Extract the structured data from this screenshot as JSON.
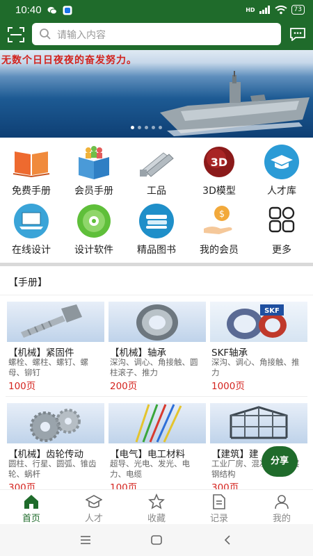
{
  "status": {
    "time": "10:40",
    "network": "HD",
    "battery": "73"
  },
  "search": {
    "placeholder": "请输入内容"
  },
  "banner": {
    "slogan": "无数个日日夜夜的奋发努力。",
    "slides": 5,
    "current": 1
  },
  "menu": [
    {
      "label": "免费手册",
      "icon": "open-book-icon"
    },
    {
      "label": "会员手册",
      "icon": "member-book-icon"
    },
    {
      "label": "工品",
      "icon": "aluminum-profile-icon"
    },
    {
      "label": "3D模型",
      "icon": "3d-model-icon"
    },
    {
      "label": "人才库",
      "icon": "graduation-cap-icon"
    },
    {
      "label": "在线设计",
      "icon": "laptop-icon"
    },
    {
      "label": "设计软件",
      "icon": "disc-icon"
    },
    {
      "label": "精品图书",
      "icon": "books-icon"
    },
    {
      "label": "我的会员",
      "icon": "money-hand-icon"
    },
    {
      "label": "更多",
      "icon": "more-grid-icon"
    }
  ],
  "section": {
    "title": "【手册】"
  },
  "cards": [
    {
      "title": "【机械】紧固件",
      "desc": "螺栓、螺柱、螺钉、螺母、铆钉",
      "pages": "100页",
      "icon": "bolt-icon"
    },
    {
      "title": "【机械】轴承",
      "desc": "深沟、调心、角接触、圆柱滚子、推力",
      "pages": "200页",
      "icon": "bearing-icon"
    },
    {
      "title": "SKF轴承",
      "desc": "深沟、调心、角接触、推力",
      "pages": "1000页",
      "icon": "skf-bearing-icon"
    },
    {
      "title": "【机械】齿轮传动",
      "desc": "圆柱、行星、圆弧、锥齿轮、蜗杆",
      "pages": "300页",
      "icon": "gears-icon"
    },
    {
      "title": "【电气】电工材料",
      "desc": "超导、光电、发光、电力、电缆",
      "pages": "100页",
      "icon": "wires-icon"
    },
    {
      "title": "【建筑】建",
      "desc": "工业厂房、混凝土、高层钢结构",
      "pages": "300页",
      "icon": "steel-frame-icon"
    }
  ],
  "share": {
    "label": "分享"
  },
  "tabs": [
    {
      "label": "首页",
      "icon": "home-icon",
      "active": true
    },
    {
      "label": "人才",
      "icon": "cap-icon",
      "active": false
    },
    {
      "label": "收藏",
      "icon": "star-icon",
      "active": false
    },
    {
      "label": "记录",
      "icon": "document-icon",
      "active": false
    },
    {
      "label": "我的",
      "icon": "user-icon",
      "active": false
    }
  ],
  "colors": {
    "brand": "#1f6b2b",
    "price": "#d4231e"
  }
}
